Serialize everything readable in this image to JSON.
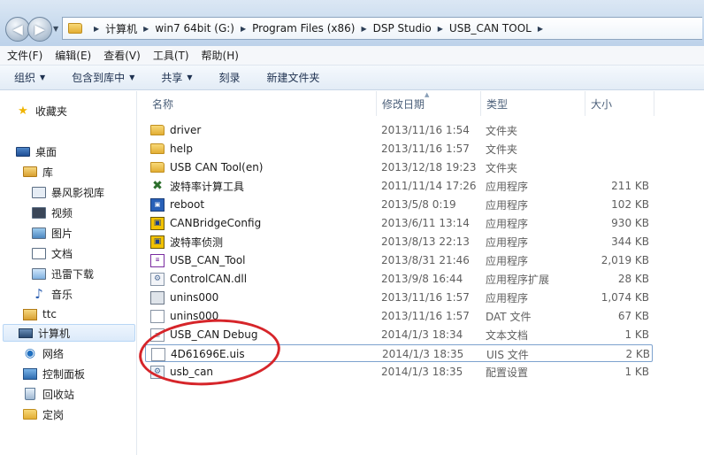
{
  "breadcrumb": [
    "计算机",
    "win7 64bit (G:)",
    "Program Files (x86)",
    "DSP Studio",
    "USB_CAN TOOL"
  ],
  "menu": [
    "文件(F)",
    "编辑(E)",
    "查看(V)",
    "工具(T)",
    "帮助(H)"
  ],
  "toolbar": [
    {
      "label": "组织",
      "dropdown": true
    },
    {
      "label": "包含到库中",
      "dropdown": true
    },
    {
      "label": "共享",
      "dropdown": true
    },
    {
      "label": "刻录",
      "dropdown": false
    },
    {
      "label": "新建文件夹",
      "dropdown": false
    }
  ],
  "nav": {
    "favorites": "收藏夹",
    "desktop": "桌面",
    "library": "库",
    "libraries": [
      "暴风影视库",
      "视频",
      "图片",
      "文档",
      "迅雷下载",
      "音乐"
    ],
    "user": "ttc",
    "computer": "计算机",
    "network": "网络",
    "control_panel": "控制面板",
    "recycle_bin": "回收站",
    "folder": "定岗"
  },
  "columns": {
    "name": "名称",
    "date": "修改日期",
    "type": "类型",
    "size": "大小"
  },
  "files": [
    {
      "name": "driver",
      "date": "2013/11/16 1:54",
      "type": "文件夹",
      "size": "",
      "icon": "folder-icon"
    },
    {
      "name": "help",
      "date": "2013/11/16 1:57",
      "type": "文件夹",
      "size": "",
      "icon": "folder-icon"
    },
    {
      "name": "USB CAN Tool(en)",
      "date": "2013/12/18 19:23",
      "type": "文件夹",
      "size": "",
      "icon": "folder-icon"
    },
    {
      "name": "波特率计算工具",
      "date": "2011/11/14 17:26",
      "type": "应用程序",
      "size": "211 KB",
      "icon": "tool-icon"
    },
    {
      "name": "reboot",
      "date": "2013/5/8 0:19",
      "type": "应用程序",
      "size": "102 KB",
      "icon": "app-icon"
    },
    {
      "name": "CANBridgeConfig",
      "date": "2013/6/11 13:14",
      "type": "应用程序",
      "size": "930 KB",
      "icon": "yellow-app-icon"
    },
    {
      "name": "波特率侦测",
      "date": "2013/8/13 22:13",
      "type": "应用程序",
      "size": "344 KB",
      "icon": "yellow-app-icon"
    },
    {
      "name": "USB_CAN_Tool",
      "date": "2013/8/31 21:46",
      "type": "应用程序",
      "size": "2,019 KB",
      "icon": "can-tool-icon"
    },
    {
      "name": "ControlCAN.dll",
      "date": "2013/9/8 16:44",
      "type": "应用程序扩展",
      "size": "28 KB",
      "icon": "dll-icon"
    },
    {
      "name": "unins000",
      "date": "2013/11/16 1:57",
      "type": "应用程序",
      "size": "1,074 KB",
      "icon": "exe-icon"
    },
    {
      "name": "unins000",
      "date": "2013/11/16 1:57",
      "type": "DAT 文件",
      "size": "67 KB",
      "icon": "doc-icon"
    },
    {
      "name": "USB_CAN Debug",
      "date": "2014/1/3 18:34",
      "type": "文本文档",
      "size": "1 KB",
      "icon": "text-file-icon"
    },
    {
      "name": "4D61696E.uis",
      "date": "2014/1/3 18:35",
      "type": "UIS 文件",
      "size": "2 KB",
      "icon": "doc-icon"
    },
    {
      "name": "usb_can",
      "date": "2014/1/3 18:35",
      "type": "配置设置",
      "size": "1 KB",
      "icon": "config-file-icon"
    }
  ],
  "colors": {
    "highlight_circle": "#d6252a",
    "selection": "#dbeafa"
  }
}
